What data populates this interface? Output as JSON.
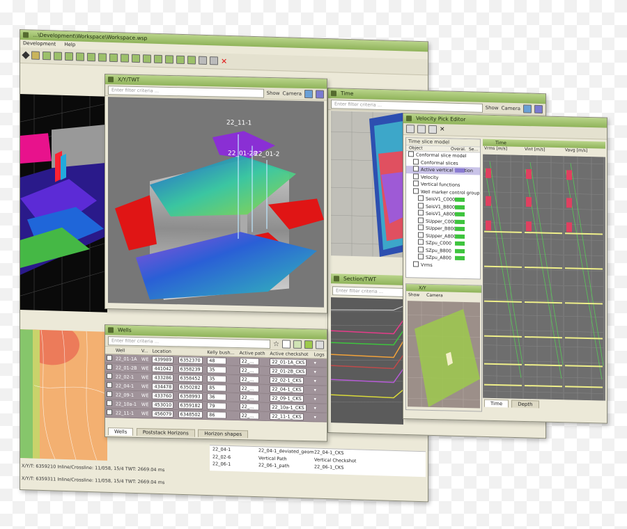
{
  "main_window": {
    "title": "...\\Development\\Workspace\\Workspace.wsp",
    "menu": [
      "Development",
      "Help"
    ],
    "status_line_1": "X/Y/T: 6359210  Inline/Crossline: 11/058, 15/4 TWT: 2669.04 ms",
    "status_line_2": "X/Y/T: 6359311  Inline/Crossline: 11/058, 15/4 TWT: 2669.04 ms"
  },
  "xyt_window": {
    "title": "X/Y/TWT",
    "filter_placeholder": "Enter filter criteria ...",
    "show_label": "Show",
    "camera_label": "Camera",
    "well_labels": [
      "22_11-1",
      "22_01-28",
      "22_01-2"
    ]
  },
  "time_window": {
    "title": "Time",
    "filter_placeholder": "Enter filter criteria ...",
    "show_label": "Show",
    "camera_label": "Camera"
  },
  "velocity_window": {
    "title": "Velocity Pick Editor",
    "tree_header": "Time slice model",
    "columns": [
      "Object",
      "Overal.",
      "Se..."
    ],
    "tree": [
      {
        "label": "Conformal slice model",
        "indent": 0,
        "swatch": ""
      },
      {
        "label": "Conformal slices",
        "indent": 1,
        "swatch": ""
      },
      {
        "label": "Active vertical function",
        "indent": 1,
        "swatch": "#8a7bd1",
        "selected": true
      },
      {
        "label": "Velocity",
        "indent": 1,
        "swatch": ""
      },
      {
        "label": "Vertical functions",
        "indent": 1,
        "swatch": ""
      },
      {
        "label": "Well marker control group",
        "indent": 1,
        "swatch": ""
      },
      {
        "label": "SeisV1_C000",
        "indent": 2,
        "swatch": "#3ec43e"
      },
      {
        "label": "SeisV1_B800",
        "indent": 2,
        "swatch": "#3ec43e"
      },
      {
        "label": "SeisV1_A800",
        "indent": 2,
        "swatch": "#3ec43e"
      },
      {
        "label": "SUpper_C000",
        "indent": 2,
        "swatch": "#3ec43e"
      },
      {
        "label": "SUpper_B800",
        "indent": 2,
        "swatch": "#3ec43e"
      },
      {
        "label": "SUpper_A800",
        "indent": 2,
        "swatch": "#3ec43e"
      },
      {
        "label": "SZpu_C000",
        "indent": 2,
        "swatch": "#3ec43e"
      },
      {
        "label": "SZpu_B800",
        "indent": 2,
        "swatch": "#3ec43e"
      },
      {
        "label": "SZpu_A800",
        "indent": 2,
        "swatch": "#3ec43e"
      },
      {
        "label": "Vrms",
        "indent": 1,
        "swatch": ""
      }
    ]
  },
  "panel_small_xy": {
    "title": "X/Y",
    "show_label": "Show",
    "camera_label": "Camera"
  },
  "velocity_panel": {
    "title": "Time",
    "col_headers": [
      "Vrms [m/s]",
      "Vint [m/s]",
      "Vavg [m/s]"
    ],
    "bottom_tabs": [
      "Time",
      "Depth"
    ]
  },
  "section_window": {
    "title": "Section/TWT",
    "filter_placeholder": "Enter filter criteria ..."
  },
  "wells_window": {
    "title": "Wells",
    "filter_placeholder": "Enter filter criteria ...",
    "columns": [
      "",
      "Well",
      "V...",
      "Location",
      "",
      "Kelly bush...",
      "Active path",
      "Active checkshot",
      "Logs"
    ],
    "rows": [
      {
        "well": "22_01-1A",
        "v": "WE",
        "x": "439989",
        "y": "6352370",
        "kb": "48",
        "ft": "ft",
        "path": "22_...",
        "checkshot": "22_01-1A_CKS"
      },
      {
        "well": "22_01-2B",
        "v": "WE",
        "x": "441042",
        "y": "6358239",
        "kb": "35",
        "ft": "ft",
        "path": "22_...",
        "checkshot": "22_01-2B_CKS"
      },
      {
        "well": "22_02-1",
        "v": "WE",
        "x": "433286",
        "y": "6358452",
        "kb": "35",
        "ft": "ft",
        "path": "22_...",
        "checkshot": "22_02-1_CKS"
      },
      {
        "well": "22_04-1",
        "v": "WE",
        "x": "434478",
        "y": "6350282",
        "kb": "85",
        "ft": "ft",
        "path": "22_...",
        "checkshot": "22_04-1_CKS"
      },
      {
        "well": "22_09-1",
        "v": "WE",
        "x": "433760",
        "y": "6358993",
        "kb": "36",
        "ft": "ft",
        "path": "22_...",
        "checkshot": "22_09-1_CKS"
      },
      {
        "well": "22_10a-1",
        "v": "WE",
        "x": "453010",
        "y": "6359182",
        "kb": "79",
        "ft": "ft",
        "path": "22_...",
        "checkshot": "22_10a-1_CKS"
      },
      {
        "well": "22_11-1",
        "v": "WE",
        "x": "456079",
        "y": "6348502",
        "kb": "86",
        "ft": "ft",
        "path": "22_...",
        "checkshot": "22_11-1_CKS"
      }
    ],
    "tabs": [
      "Wells",
      "Poststack Horizons",
      "Horizon shapes"
    ]
  },
  "bottom_list": {
    "rows": [
      {
        "name": "22_04-1",
        "path": "22_04-1_deviated_geom",
        "checkshot": "22_04-1_CKS"
      },
      {
        "name": "22_02-6",
        "path": "Vertical Path",
        "checkshot": "Vertical Checkshot"
      },
      {
        "name": "22_06-1",
        "path": "22_06-1_path",
        "checkshot": "22_06-1_CKS"
      }
    ]
  },
  "colors": {
    "title_green": "#9bc06a",
    "wells_row": "#a0939a",
    "accent_red": "#e01515"
  }
}
